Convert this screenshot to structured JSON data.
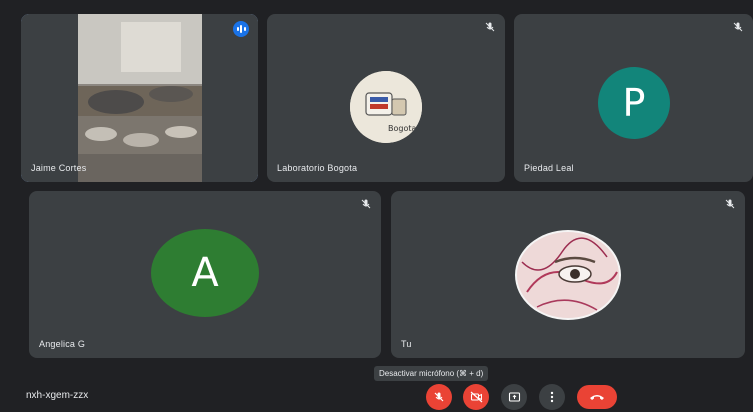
{
  "participants": [
    {
      "name": "Jaime Cortes",
      "state": "speaking"
    },
    {
      "name": "Laboratorio Bogota",
      "state": "muted"
    },
    {
      "name": "Piedad Leal",
      "state": "muted",
      "avatar_letter": "P",
      "avatar_color": "#12857a"
    },
    {
      "name": "Angelica G",
      "state": "muted",
      "avatar_letter": "A",
      "avatar_color": "#2e7d32"
    },
    {
      "name": "Tu",
      "state": "muted"
    }
  ],
  "meeting": {
    "code": "nxh-xgem-zzx"
  },
  "tooltip": {
    "text": "Desactivar micrófono (⌘ + d)"
  },
  "controls": [
    {
      "name": "microphone",
      "icon": "mic-off-icon",
      "color": "#ea4335"
    },
    {
      "name": "camera",
      "icon": "camera-off-icon",
      "color": "#ea4335"
    },
    {
      "name": "present",
      "icon": "present-screen-icon",
      "color": "#3c4043"
    },
    {
      "name": "more",
      "icon": "more-vert-icon",
      "color": "#3c4043"
    },
    {
      "name": "end-call",
      "icon": "call-end-icon",
      "color": "#ea4335"
    }
  ],
  "colors": {
    "background": "#202124",
    "tile": "#3c4043",
    "active_outline": "#8ab4f8",
    "danger": "#ea4335"
  }
}
